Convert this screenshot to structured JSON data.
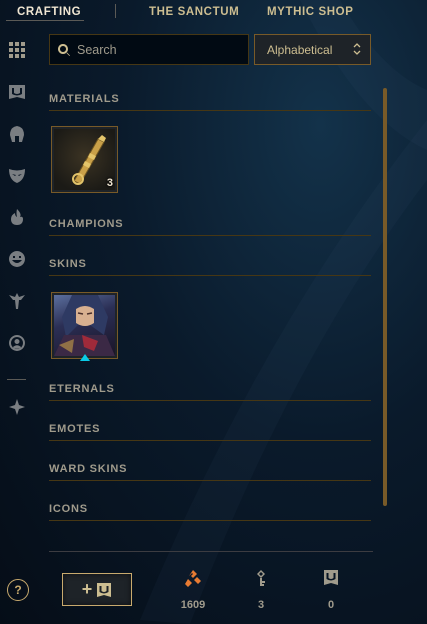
{
  "tabs": [
    {
      "label": "CRAFTING",
      "active": true
    },
    {
      "label": "THE SANCTUM",
      "active": false
    },
    {
      "label": "MYTHIC SHOP",
      "active": false
    }
  ],
  "sidebar": {
    "items": [
      {
        "name": "all-grid-icon",
        "active": true
      },
      {
        "name": "chest-icon",
        "active": false
      },
      {
        "name": "helmet-icon",
        "active": false
      },
      {
        "name": "mask-icon",
        "active": false
      },
      {
        "name": "flame-icon",
        "active": false
      },
      {
        "name": "emote-icon",
        "active": false
      },
      {
        "name": "ward-icon",
        "active": false
      },
      {
        "name": "profile-icon",
        "active": false
      },
      {
        "name": "tft-icon",
        "active": false
      }
    ]
  },
  "search": {
    "placeholder": "Search",
    "value": ""
  },
  "sort": {
    "selected": "Alphabetical"
  },
  "sections": [
    {
      "label": "MATERIALS"
    },
    {
      "label": "CHAMPIONS"
    },
    {
      "label": "SKINS"
    },
    {
      "label": "ETERNALS"
    },
    {
      "label": "EMOTES"
    },
    {
      "label": "WARD SKINS"
    },
    {
      "label": "ICONS"
    }
  ],
  "materials_item": {
    "name": "hextech key",
    "count": "3"
  },
  "skins_item": {
    "name": "champion skin shard"
  },
  "footer": {
    "help_label": "?",
    "add_label": "+",
    "currencies": [
      {
        "icon": "orange-essence-icon",
        "value": "1609"
      },
      {
        "icon": "key-icon",
        "value": "3"
      },
      {
        "icon": "chest-icon",
        "value": "0"
      }
    ]
  },
  "colors": {
    "gold": "#c8aa6e",
    "gold_text": "#cdbe91",
    "orange_essence": "#e87b32",
    "hextech_blue": "#0acbe6"
  }
}
